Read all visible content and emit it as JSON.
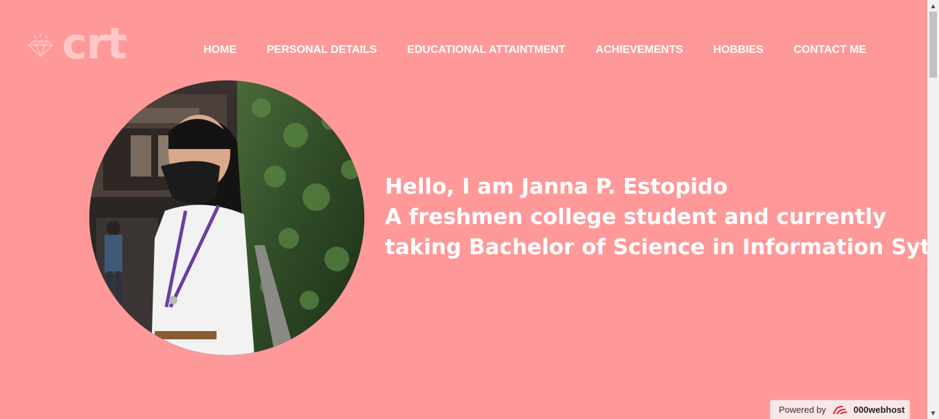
{
  "logo": {
    "icon": "diamond-icon",
    "text": "crt"
  },
  "nav": {
    "items": [
      {
        "label": "HOME"
      },
      {
        "label": "PERSONAL DETAILS"
      },
      {
        "label": "EDUCATIONAL ATTAINTMENT"
      },
      {
        "label": "ACHIEVEMENTS"
      },
      {
        "label": "HOBBIES"
      },
      {
        "label": "CONTACT ME"
      }
    ]
  },
  "hero": {
    "photo_icon": "profile-photo",
    "line1": "Hello, I am Janna P. Estopido",
    "line2": "A freshmen college student and currently",
    "line3": "taking Bachelor of Science in Information Sytem"
  },
  "badge": {
    "powered_by": "Powered by",
    "brand": "000webhost",
    "icon": "webhost-logo-icon"
  },
  "colors": {
    "background": "#ff9999",
    "logo": "#ffc7c7",
    "text": "#ffffff"
  },
  "scrollbar": {
    "up_icon": "▲",
    "down_icon": "▼"
  }
}
